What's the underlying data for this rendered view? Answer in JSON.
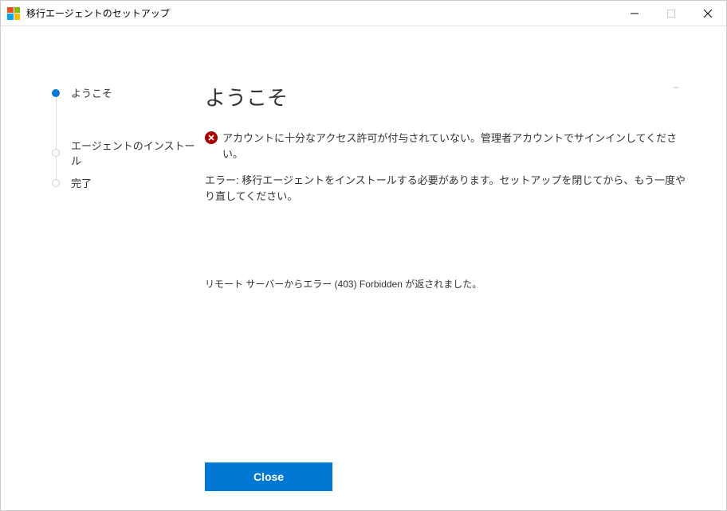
{
  "titlebar": {
    "title": "移行エージェントのセットアップ"
  },
  "sidebar": {
    "steps": [
      {
        "label": "ようこそ",
        "active": true
      },
      {
        "label": "エージェントのインストール",
        "active": false
      },
      {
        "label": "完了",
        "active": false
      }
    ]
  },
  "main": {
    "title": "ようこそ",
    "error_message": "アカウントに十分なアクセス許可が付与されていない。管理者アカウントでサインインしてください。",
    "instruction": "エラー: 移行エージェントをインストールする必要があります。セットアップを閉じてから、もう一度やり直してください。",
    "server_error": "リモート サーバーからエラー (403) Forbidden が返されました。"
  },
  "footer": {
    "close_label": "Close"
  }
}
